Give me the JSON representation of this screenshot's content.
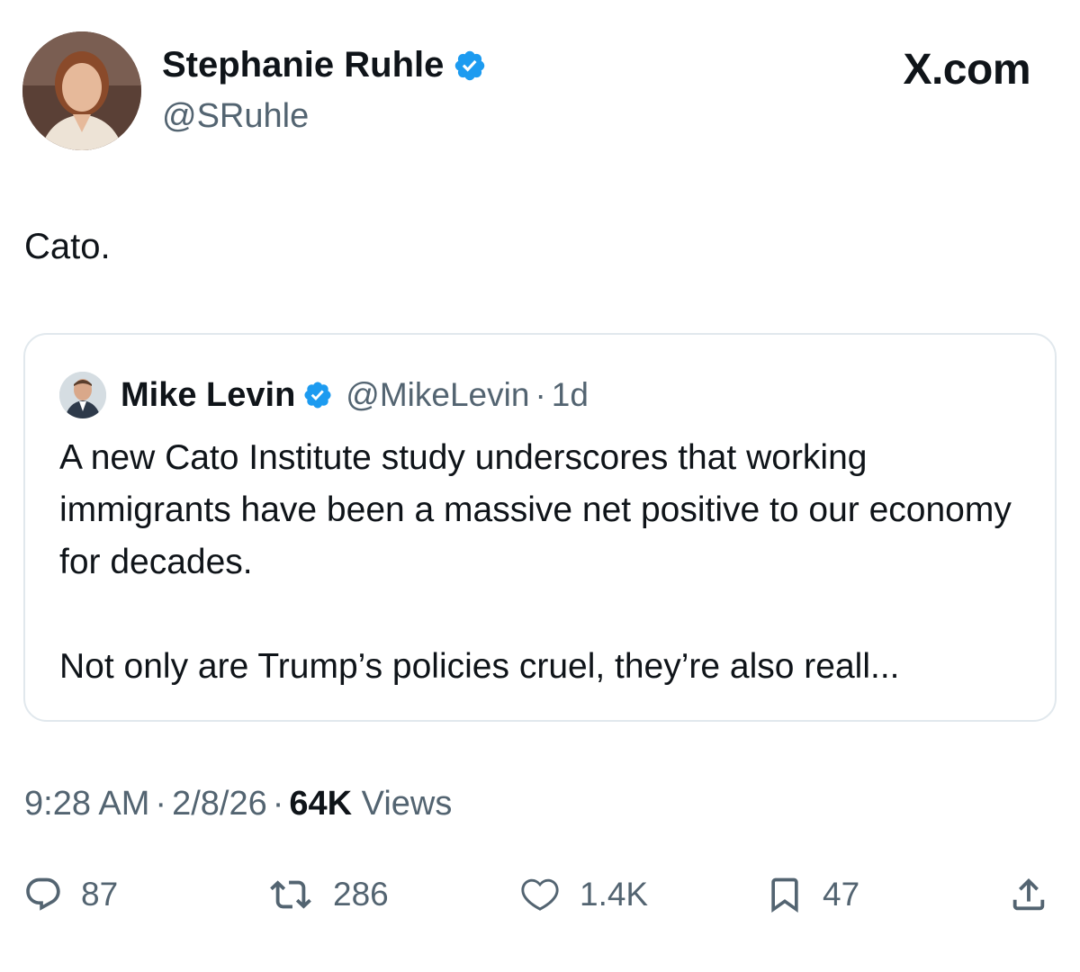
{
  "author": {
    "name": "Stephanie Ruhle",
    "handle": "@SRuhle"
  },
  "brand": "X.com",
  "tweet": {
    "text": "Cato."
  },
  "quoted_tweet": {
    "name": "Mike Levin",
    "handle": "@MikeLevin",
    "separator": "·",
    "time": "1d",
    "paragraphs": [
      "A new Cato Institute study underscores that working immigrants have been a massive net positive to our economy for decades.",
      "Not only are Trump’s policies cruel, they’re also reall..."
    ]
  },
  "meta": {
    "time": "9:28 AM",
    "date": "2/8/26",
    "separator": "·",
    "views_count": "64K",
    "views_label": "Views"
  },
  "actions": {
    "replies": "87",
    "reposts": "286",
    "likes": "1.4K",
    "bookmarks": "47"
  },
  "colors": {
    "verified": "#1d9bf0",
    "secondary_text": "#536471",
    "border": "#e1e8ed"
  },
  "icons": [
    "verified-badge-icon",
    "reply-icon",
    "repost-icon",
    "like-icon",
    "bookmark-icon",
    "share-icon"
  ]
}
